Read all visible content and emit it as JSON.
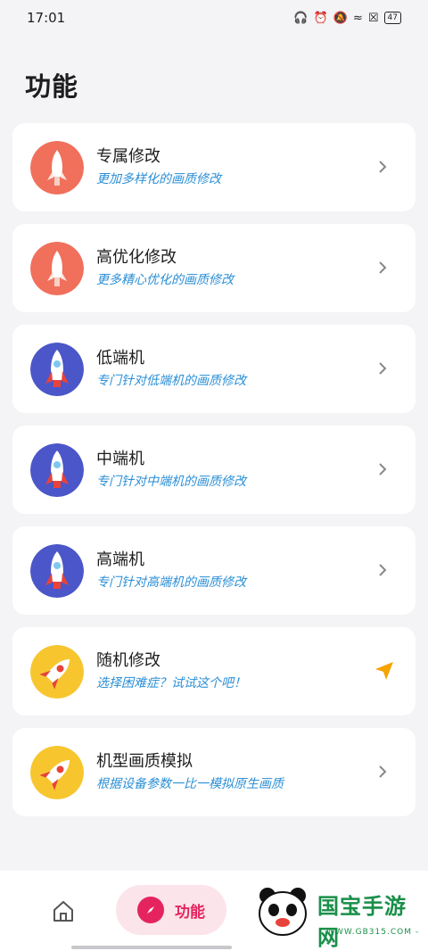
{
  "status_bar": {
    "time": "17:01",
    "battery": "47"
  },
  "page_title": "功能",
  "cards": [
    {
      "title": "专属修改",
      "subtitle": "更加多样化的画质修改",
      "icon": "red-rocket-icon",
      "action": "chevron-right-icon"
    },
    {
      "title": "高优化修改",
      "subtitle": "更多精心优化的画质修改",
      "icon": "red-rocket-icon",
      "action": "chevron-right-icon"
    },
    {
      "title": "低端机",
      "subtitle": "专门针对低端机的画质修改",
      "icon": "blue-rocket-icon",
      "action": "chevron-right-icon"
    },
    {
      "title": "中端机",
      "subtitle": "专门针对中端机的画质修改",
      "icon": "blue-rocket-icon",
      "action": "chevron-right-icon"
    },
    {
      "title": "高端机",
      "subtitle": "专门针对高端机的画质修改",
      "icon": "blue-rocket-icon",
      "action": "chevron-right-icon"
    },
    {
      "title": "随机修改",
      "subtitle": "选择困难症？试试这个吧！",
      "icon": "yellow-rocket-icon",
      "action": "send-arrow-icon"
    },
    {
      "title": "机型画质模拟",
      "subtitle": "根据设备参数一比一模拟原生画质",
      "icon": "yellow-rocket-icon",
      "action": "chevron-right-icon"
    }
  ],
  "bottom_nav": {
    "active_label": "功能"
  },
  "watermark": {
    "title": "国宝手游网",
    "url": "- WWW.GB315.COM -"
  },
  "colors": {
    "accent": "#e5245f",
    "subtitle": "#2b8fd6",
    "red_icon": "#f0705c",
    "blue_icon": "#4b56c8",
    "yellow_icon": "#f7c62f"
  }
}
